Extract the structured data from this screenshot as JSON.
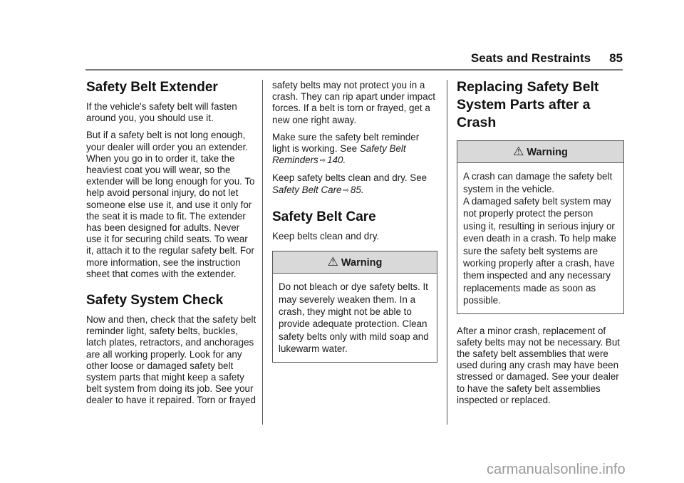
{
  "header": {
    "section_title": "Seats and Restraints",
    "page_number": "85"
  },
  "column1": {
    "extender_heading": "Safety Belt Extender",
    "extender_p1": "If the vehicle's safety belt will fasten around you, you should use it.",
    "extender_p2": "But if a safety belt is not long enough, your dealer will order you an extender. When you go in to order it, take the heaviest coat you will wear, so the extender will be long enough for you. To help avoid personal injury, do not let someone else use it, and use it only for the seat it is made to fit. The extender has been designed for adults. Never use it for securing child seats. To wear it, attach it to the regular safety belt. For more information, see the instruction sheet that comes with the extender.",
    "check_heading": "Safety System Check",
    "check_p1": "Now and then, check that the safety belt reminder light, safety belts, buckles, latch plates, retractors, and anchorages are all working properly. Look for any other loose or damaged safety belt system parts that might keep a safety belt system from doing its job. See your dealer to have it repaired. Torn or frayed"
  },
  "column2": {
    "check_p1_cont": "safety belts may not protect you in a crash. They can rip apart under impact forces. If a belt is torn or frayed, get a new one right away.",
    "check_p2_text": "Make sure the safety belt reminder light is working. See",
    "check_p2_ref": "Safety Belt Reminders",
    "check_p2_page": "140",
    "check_p3_text": "Keep safety belts clean and dry. See",
    "check_p3_ref": "Safety Belt Care",
    "check_p3_page": "85",
    "care_heading": "Safety Belt Care",
    "care_p1": "Keep belts clean and dry.",
    "care_warning_title": "Warning",
    "care_warning_body": "Do not bleach or dye safety belts. It may severely weaken them. In a crash, they might not be able to provide adequate protection. Clean safety belts only with mild soap and lukewarm water."
  },
  "column3": {
    "replace_heading": "Replacing Safety Belt System Parts after a Crash",
    "replace_warning_title": "Warning",
    "replace_warning_body_1": "A crash can damage the safety belt system in the vehicle.",
    "replace_warning_body_2": "A damaged safety belt system may not properly protect the person using it, resulting in serious injury or even death in a crash. To help make sure the safety belt systems are working properly after a crash, have them inspected and any necessary replacements made as soon as possible.",
    "replace_p1": "After a minor crash, replacement of safety belts may not be necessary. But the safety belt assemblies that were used during any crash may have been stressed or damaged. See your dealer to have the safety belt assemblies inspected or replaced."
  },
  "icons": {
    "warning_glyph": "⚠",
    "ref_arrow_glyph": "⇨"
  },
  "watermark": "carmanualsonline.info",
  "colors": {
    "warning_header_bg": "#d9d9d9",
    "watermark": "#9a9a9a"
  }
}
